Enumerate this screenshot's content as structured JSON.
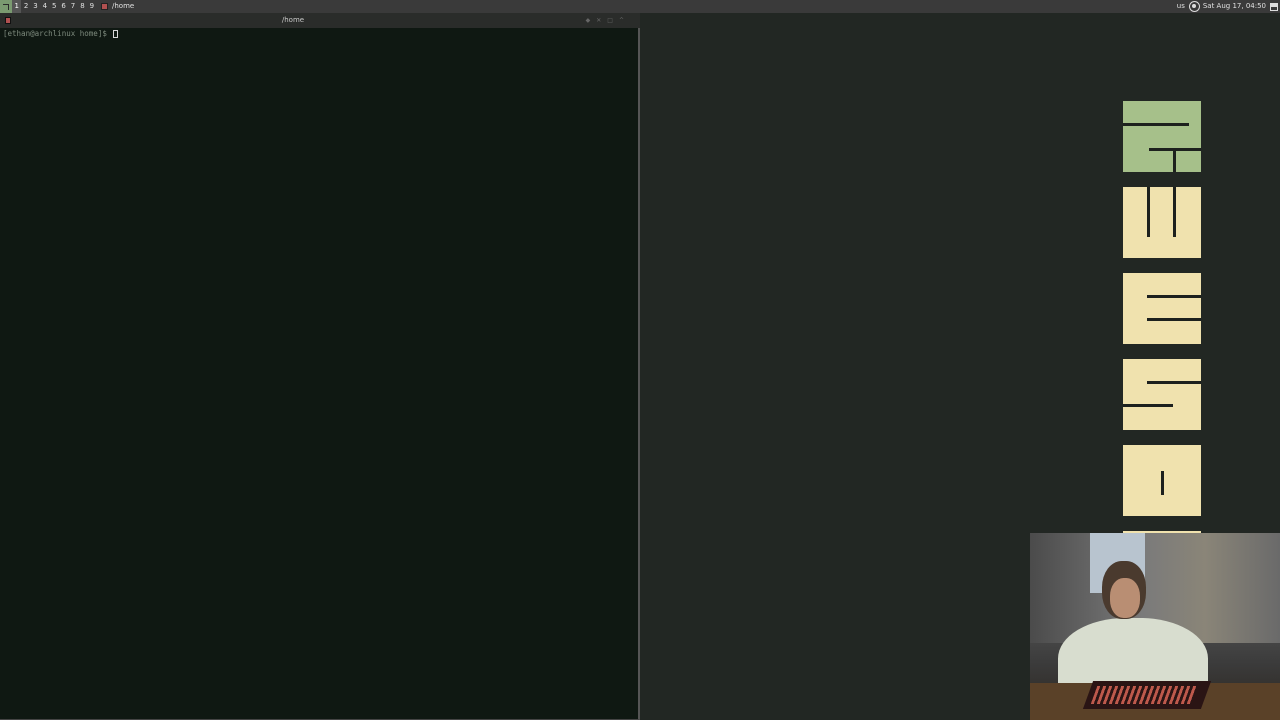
{
  "wibar": {
    "tags": [
      "1",
      "2",
      "3",
      "4",
      "5",
      "6",
      "7",
      "8",
      "9"
    ],
    "active_tag": "1",
    "task_title": "/home",
    "keyboard_layout": "us",
    "clock": "Sat Aug 17, 04:50",
    "background": "#3a3a3a"
  },
  "terminal": {
    "title": "/home",
    "prompt": "[ethan@archlinux home]$ ",
    "background": "#0f1812"
  },
  "desktop": {
    "background": "#222723",
    "logo_colors": {
      "accent": "#a6c08a",
      "cream": "#f0e2ae"
    }
  }
}
